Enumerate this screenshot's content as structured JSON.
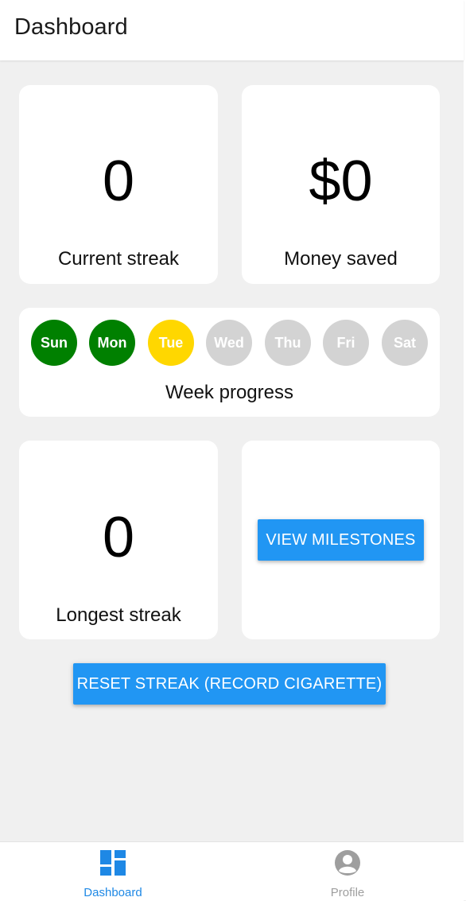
{
  "header": {
    "title": "Dashboard"
  },
  "stats": {
    "current_streak": {
      "value": "0",
      "label": "Current streak"
    },
    "money_saved": {
      "value": "$0",
      "label": "Money saved"
    },
    "longest_streak": {
      "value": "0",
      "label": "Longest streak"
    }
  },
  "week": {
    "label": "Week progress",
    "days": [
      {
        "label": "Sun",
        "status": "completed",
        "color": "#008000"
      },
      {
        "label": "Mon",
        "status": "completed",
        "color": "#008000"
      },
      {
        "label": "Tue",
        "status": "today",
        "color": "#ffd700"
      },
      {
        "label": "Wed",
        "status": "upcoming",
        "color": "#d3d3d3"
      },
      {
        "label": "Thu",
        "status": "upcoming",
        "color": "#d3d3d3"
      },
      {
        "label": "Fri",
        "status": "upcoming",
        "color": "#d3d3d3"
      },
      {
        "label": "Sat",
        "status": "upcoming",
        "color": "#d3d3d3"
      }
    ]
  },
  "buttons": {
    "view_milestones": "VIEW MILESTONES",
    "reset_streak": "RESET STREAK (RECORD CIGARETTE)"
  },
  "tabbar": {
    "tabs": [
      {
        "label": "Dashboard",
        "icon": "dashboard-icon",
        "active": true
      },
      {
        "label": "Profile",
        "icon": "profile-icon",
        "active": false
      }
    ]
  },
  "colors": {
    "accent": "#2196f3",
    "tab_active": "#1e88e5",
    "tab_inactive": "#9e9e9e",
    "background": "#f0f0f0"
  }
}
